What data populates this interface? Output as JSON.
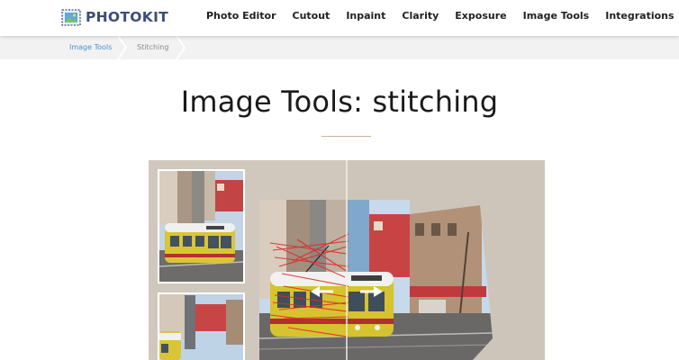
{
  "brand": {
    "name": "PHOTOKIT",
    "logo_icon": "photo-frame-icon",
    "color": "#3b4e7a"
  },
  "nav": {
    "items": [
      {
        "label": "Photo Editor"
      },
      {
        "label": "Cutout"
      },
      {
        "label": "Inpaint"
      },
      {
        "label": "Clarity"
      },
      {
        "label": "Exposure"
      },
      {
        "label": "Image Tools"
      },
      {
        "label": "Integrations"
      }
    ]
  },
  "breadcrumb": {
    "items": [
      {
        "label": "Image Tools",
        "link": true
      },
      {
        "label": "Stitching",
        "link": false
      }
    ],
    "link_color": "#4a8fd0"
  },
  "page": {
    "title": "Image Tools: stitching",
    "accent_rule_color": "#c9b48e"
  },
  "illustration": {
    "background_color": "#d1c8bd",
    "icons": [
      "arrow-left-icon",
      "arrow-right-icon"
    ]
  }
}
